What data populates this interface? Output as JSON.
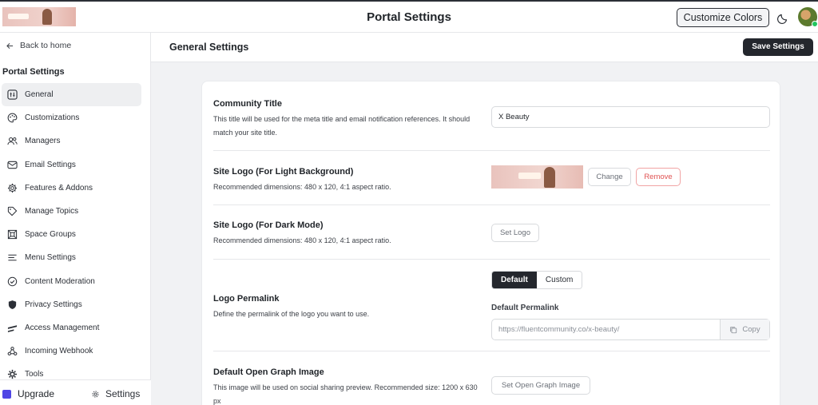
{
  "header": {
    "title": "Portal Settings",
    "customize_label": "Customize Colors"
  },
  "sidebar": {
    "back_label": "Back to home",
    "section_title": "Portal Settings",
    "items": [
      {
        "label": "General",
        "icon": "sliders-icon",
        "active": true
      },
      {
        "label": "Customizations",
        "icon": "palette-icon"
      },
      {
        "label": "Managers",
        "icon": "users-icon"
      },
      {
        "label": "Email Settings",
        "icon": "mail-icon"
      },
      {
        "label": "Features & Addons",
        "icon": "gear-icon"
      },
      {
        "label": "Manage Topics",
        "icon": "tag-icon"
      },
      {
        "label": "Space Groups",
        "icon": "grid-icon"
      },
      {
        "label": "Menu Settings",
        "icon": "menu-icon"
      },
      {
        "label": "Content Moderation",
        "icon": "check-circle-icon"
      },
      {
        "label": "Privacy Settings",
        "icon": "shield-icon"
      },
      {
        "label": "Access Management",
        "icon": "access-icon"
      },
      {
        "label": "Incoming Webhook",
        "icon": "webhook-icon"
      },
      {
        "label": "Tools",
        "icon": "tools-icon"
      }
    ],
    "upgrade_label": "Upgrade",
    "settings_label": "Settings"
  },
  "subheader": {
    "title": "General Settings",
    "save_label": "Save Settings"
  },
  "form": {
    "community_title": {
      "label": "Community Title",
      "description": "This title will be used for the meta title and email notification references. It should match your site title.",
      "value": "X Beauty"
    },
    "logo_light": {
      "label": "Site Logo (For Light Background)",
      "description": "Recommended dimensions: 480 x 120, 4:1 aspect ratio.",
      "change_label": "Change",
      "remove_label": "Remove"
    },
    "logo_dark": {
      "label": "Site Logo (For Dark Mode)",
      "description": "Recommended dimensions: 480 x 120, 4:1 aspect ratio.",
      "set_label": "Set Logo"
    },
    "logo_permalink": {
      "label": "Logo Permalink",
      "description": "Define the permalink of the logo you want to use.",
      "options": [
        "Default",
        "Custom"
      ],
      "selected": "Default",
      "sub_label": "Default Permalink",
      "url": "https://fluentcommunity.co/x-beauty/",
      "copy_label": "Copy"
    },
    "og_image": {
      "label": "Default Open Graph Image",
      "description": "This image will be used on social sharing preview. Recommended size: 1200 x 630 px",
      "set_label": "Set Open Graph Image"
    }
  },
  "colors": {
    "accent_dark": "#24272d",
    "remove_red": "#e05252",
    "upgrade_purple": "#4f46e5"
  }
}
